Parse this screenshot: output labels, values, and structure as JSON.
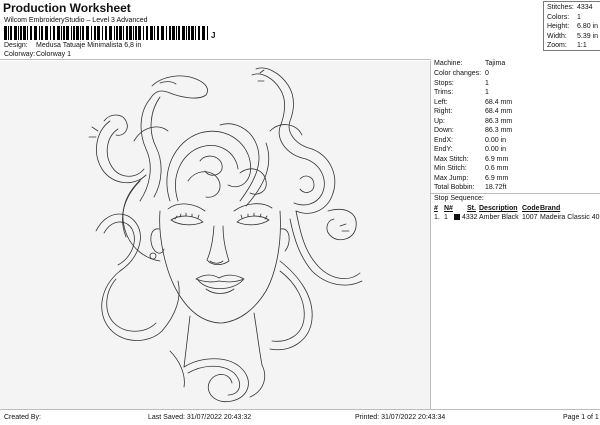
{
  "header": {
    "title": "Production Worksheet",
    "subtitle": "Wilcom EmbroideryStudio – Level 3 Advanced",
    "barcode_mark": "J"
  },
  "stats": [
    {
      "label": "Stitches:",
      "value": "4334"
    },
    {
      "label": "Colors:",
      "value": "1"
    },
    {
      "label": "Height:",
      "value": "6.80 in"
    },
    {
      "label": "Width:",
      "value": "5.39 in"
    },
    {
      "label": "Zoom:",
      "value": "1:1"
    }
  ],
  "meta": {
    "design_label": "Design:",
    "design_value": "Medusa Tatuaje Minimalista 6,8 in",
    "colorway_label": "Colorway:",
    "colorway_value": "Colorway 1"
  },
  "machine_info": [
    {
      "label": "Machine:",
      "value": "Tajima"
    },
    {
      "label": "Color changes:",
      "value": "0"
    },
    {
      "label": "Stops:",
      "value": "1"
    },
    {
      "label": "Trims:",
      "value": "1"
    },
    {
      "label": "Left:",
      "value": "68.4 mm"
    },
    {
      "label": "Right:",
      "value": "68.4 mm"
    },
    {
      "label": "Up:",
      "value": "86.3 mm"
    },
    {
      "label": "Down:",
      "value": "86.3 mm"
    },
    {
      "label": "EndX:",
      "value": "0.00 in"
    },
    {
      "label": "EndY:",
      "value": "0.00 in"
    },
    {
      "label": "Max Stitch:",
      "value": "6.9 mm"
    },
    {
      "label": "Min Stitch:",
      "value": "0.6 mm"
    },
    {
      "label": "Max Jump:",
      "value": "6.9 mm"
    },
    {
      "label": "Total Bobbin:",
      "value": "18.72ft"
    }
  ],
  "stop_sequence": {
    "title": "Stop Sequence:",
    "columns": [
      "#",
      "N#",
      "St.",
      "Description",
      "Code",
      "Brand"
    ],
    "rows": [
      {
        "num": "1.",
        "needle": "1",
        "stitches": "4332",
        "description": "Amber Black",
        "code": "1007",
        "brand": "Madeira Classic 40",
        "color": "#111111"
      }
    ]
  },
  "footer": {
    "created_by": "Created By:",
    "last_saved": "Last Saved: 31/07/2022 20:43:32",
    "printed": "Printed: 31/07/2022 20:43:34",
    "page": "Page 1 of 1"
  }
}
